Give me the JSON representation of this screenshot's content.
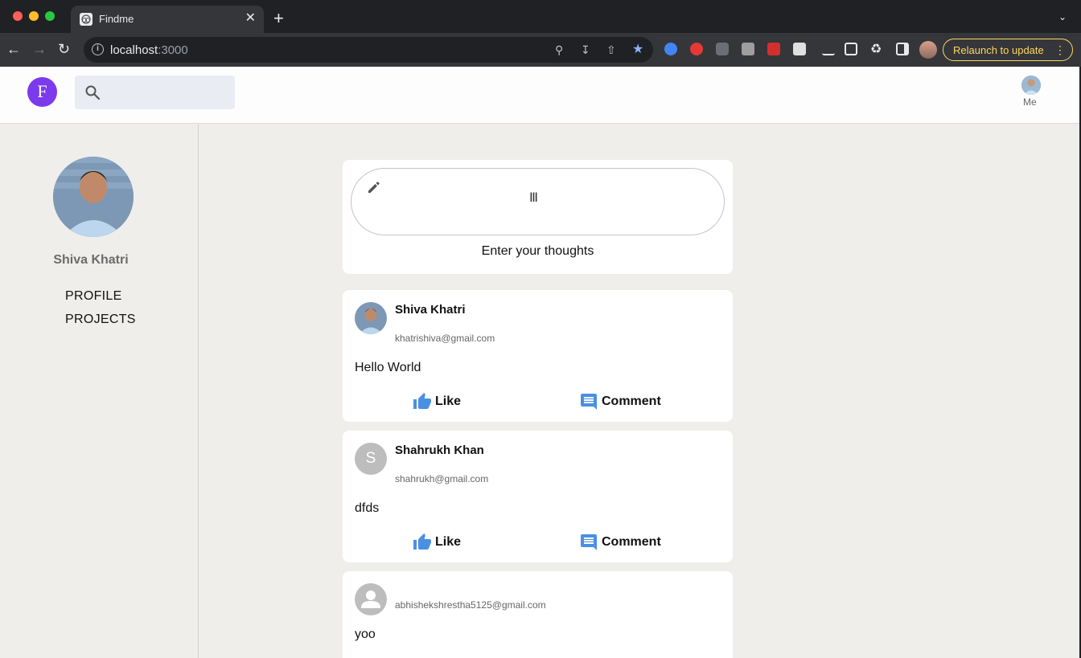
{
  "browser": {
    "tab_title": "Findme",
    "tab_close": "✕",
    "new_tab": "+",
    "url_host": "localhost",
    "url_port": ":3000",
    "relaunch_label": "Relaunch to update",
    "relaunch_menu": "⋮"
  },
  "app": {
    "logo_letter": "F",
    "search_placeholder": "",
    "me_label": "Me"
  },
  "sidebar": {
    "user_name": "Shiva Khatri",
    "links": [
      "PROFILE",
      "PROJECTS"
    ]
  },
  "composer": {
    "hint": "Enter your thoughts"
  },
  "posts": [
    {
      "author": "Shiva Khatri",
      "email": "khatrishiva@gmail.com",
      "text": "Hello World",
      "like_label": "Like",
      "comment_label": "Comment"
    },
    {
      "author": "Shahrukh Khan",
      "avatar_letter": "S",
      "email": "shahrukh@gmail.com",
      "text": "dfds",
      "like_label": "Like",
      "comment_label": "Comment"
    },
    {
      "author": "",
      "email": "abhishekshrestha5125@gmail.com",
      "text": "yoo"
    }
  ],
  "colors": {
    "accent_blue": "#4a90e2",
    "logo_purple": "#7c3aed",
    "relaunch_yellow": "#fdd663"
  }
}
